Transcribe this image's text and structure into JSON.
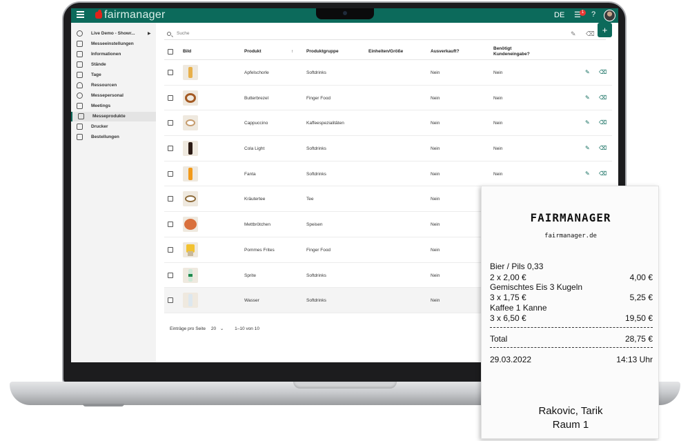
{
  "header": {
    "logo_text": "fairmanager",
    "language": "DE",
    "notification_count": "1",
    "accent_color": "#0c6a5b",
    "brand_red": "#e2231a"
  },
  "sidebar": {
    "items": [
      {
        "label": "Live Demo - Showr...",
        "icon": "back-arrow-icon"
      },
      {
        "label": "Messeeinstellungen",
        "icon": "users-icon"
      },
      {
        "label": "Informationen",
        "icon": "info-icon"
      },
      {
        "label": "Stände",
        "icon": "stands-icon"
      },
      {
        "label": "Tage",
        "icon": "calendar-icon"
      },
      {
        "label": "Ressourcen",
        "icon": "bell-icon"
      },
      {
        "label": "Messepersonal",
        "icon": "person-icon"
      },
      {
        "label": "Meetings",
        "icon": "meetings-icon"
      },
      {
        "label": "Messeprodukte",
        "icon": "box-icon",
        "active": true
      },
      {
        "label": "Drucker",
        "icon": "printer-icon"
      },
      {
        "label": "Bestellungen",
        "icon": "orders-icon"
      }
    ]
  },
  "search": {
    "placeholder": "Suche"
  },
  "table": {
    "columns": {
      "bild": "Bild",
      "produkt": "Produkt",
      "produktgruppe": "Produktgruppe",
      "einheiten": "Einheiten/Größe",
      "ausverkauft": "Ausverkauft?",
      "benoetigt_1": "Benötigt",
      "benoetigt_2": "Kundeneingabe?"
    },
    "rows": [
      {
        "produkt": "Apfelschorle",
        "gruppe": "Softdrinks",
        "ausverkauft": "Nein",
        "kundeneingabe": "Nein"
      },
      {
        "produkt": "Butterbrezel",
        "gruppe": "Finger Food",
        "ausverkauft": "Nein",
        "kundeneingabe": "Nein"
      },
      {
        "produkt": "Cappuccino",
        "gruppe": "Kaffeespezialitäten",
        "ausverkauft": "Nein",
        "kundeneingabe": "Nein"
      },
      {
        "produkt": "Cola Light",
        "gruppe": "Softdrinks",
        "ausverkauft": "Nein",
        "kundeneingabe": "Nein"
      },
      {
        "produkt": "Fanta",
        "gruppe": "Softdrinks",
        "ausverkauft": "Nein",
        "kundeneingabe": "Nein"
      },
      {
        "produkt": "Kräutertee",
        "gruppe": "Tee",
        "ausverkauft": "Nein",
        "kundeneingabe": ""
      },
      {
        "produkt": "Mettbrötchen",
        "gruppe": "Speisen",
        "ausverkauft": "Nein",
        "kundeneingabe": ""
      },
      {
        "produkt": "Pommes Frites",
        "gruppe": "Finger Food",
        "ausverkauft": "Nein",
        "kundeneingabe": ""
      },
      {
        "produkt": "Sprite",
        "gruppe": "Softdrinks",
        "ausverkauft": "Nein",
        "kundeneingabe": ""
      },
      {
        "produkt": "Wasser",
        "gruppe": "Softdrinks",
        "ausverkauft": "Nein",
        "kundeneingabe": ""
      }
    ]
  },
  "pagination": {
    "label": "Einträge pro Seite",
    "per_page": "20",
    "range": "1–10 von 10"
  },
  "receipt": {
    "title": "FAIRMANAGER",
    "url": "fairmanager.de",
    "items": [
      {
        "name": "Bier / Pils 0,33",
        "qty": "2 x 2,00 €",
        "total": "4,00 €"
      },
      {
        "name": "Gemischtes Eis 3 Kugeln",
        "qty": "3 x 1,75 €",
        "total": "5,25 €"
      },
      {
        "name": "Kaffee 1 Kanne",
        "qty": "3 x 6,50 €",
        "total": "19,50 €"
      }
    ],
    "total_label": "Total",
    "total_value": "28,75 €",
    "date": "29.03.2022",
    "time": "14:13 Uhr",
    "name": "Rakovic, Tarik",
    "room": "Raum 1"
  }
}
